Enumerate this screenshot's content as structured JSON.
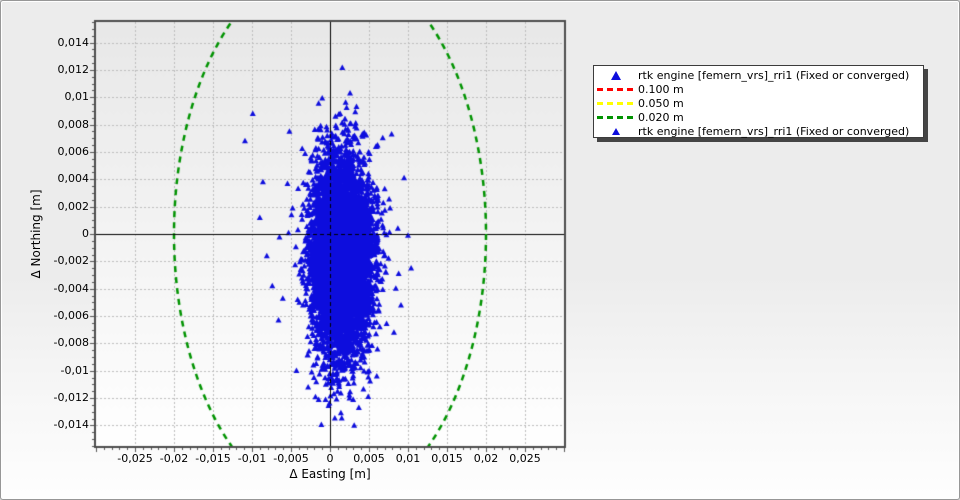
{
  "window": {
    "background_top": "#ececec",
    "background_bottom": "#fdfdfd",
    "frame_color": "#979797"
  },
  "chart_data": {
    "type": "scatter",
    "xlabel": "Δ Easting [m]",
    "ylabel": "Δ Northing [m]",
    "xlim": [
      -0.03,
      0.03
    ],
    "ylim": [
      -0.0155,
      0.0155
    ],
    "grid": "dashed-major",
    "x_ticks": {
      "values": [
        -0.025,
        -0.02,
        -0.015,
        -0.01,
        -0.005,
        0,
        0.005,
        0.01,
        0.015,
        0.02,
        0.025
      ],
      "labels": [
        "-0,025",
        "-0,02",
        "-0,015",
        "-0,01",
        "-0,005",
        "0",
        "0,005",
        "0,01",
        "0,015",
        "0,02",
        "0,025"
      ]
    },
    "y_ticks": {
      "values": [
        0.014,
        0.012,
        0.01,
        0.008,
        0.006,
        0.004,
        0.002,
        0,
        -0.002,
        -0.004,
        -0.006,
        -0.008,
        -0.01,
        -0.012,
        -0.014
      ],
      "labels": [
        "0,014",
        "0,012",
        "0,01",
        "0,008",
        "0,006",
        "0,004",
        "0,002",
        "0",
        "-0,002",
        "-0,004",
        "-0,006",
        "-0,008",
        "-0,01",
        "-0,012",
        "-0,014"
      ]
    },
    "minor_tick_step_x": 0.001,
    "minor_tick_step_y": 0.0005,
    "zero_cross_lines": true,
    "series": [
      {
        "name": "rtk engine [femern_vrs]_rri1 (Fixed or converged)",
        "marker": "triangle",
        "color": "#0d0ddd",
        "cluster": {
          "n": 7000,
          "center": [
            0.0015,
            -0.0017
          ],
          "sigma": [
            0.0019,
            0.0034
          ],
          "seed": 1337
        },
        "outliers": [
          [
            -0.0099,
            0.0088
          ],
          [
            -0.0109,
            0.0068
          ],
          [
            -0.0052,
            0.0075
          ],
          [
            0.0007,
            0.0086
          ],
          [
            0.0019,
            0.0084
          ],
          [
            0.0033,
            0.0081
          ],
          [
            -0.0012,
            0.0079
          ],
          [
            0.0044,
            0.0074
          ],
          [
            0.0013,
            0.0088
          ],
          [
            0.0061,
            0.0065
          ],
          [
            0.0079,
            0.0073
          ],
          [
            0.0095,
            0.0041
          ],
          [
            0.0087,
            0.0004
          ],
          [
            0.01,
            -0.0001
          ],
          [
            0.0104,
            -0.0025
          ],
          [
            0.0091,
            -0.0052
          ],
          [
            0.0082,
            -0.0072
          ],
          [
            -0.0074,
            -0.0038
          ],
          [
            -0.0081,
            -0.0016
          ],
          [
            -0.009,
            0.0012
          ],
          [
            -0.0086,
            0.0038
          ],
          [
            -0.0066,
            -0.0063
          ],
          [
            -0.0043,
            -0.01
          ],
          [
            -0.0028,
            -0.0112
          ],
          [
            0.0005,
            -0.0117
          ],
          [
            0.0037,
            -0.0127
          ],
          [
            0.0031,
            -0.014
          ],
          [
            0.006,
            -0.0104
          ],
          [
            0.0049,
            -0.0119
          ]
        ]
      }
    ],
    "reference_circles": [
      {
        "radius_m": 0.1,
        "label": "0.100 m",
        "color": "#ff0000"
      },
      {
        "radius_m": 0.05,
        "label": "0.050 m",
        "color": "#ffff00"
      },
      {
        "radius_m": 0.02,
        "label": "0.020 m",
        "color": "#009300"
      }
    ]
  },
  "legend": {
    "items": [
      {
        "icon": "triangle-marker",
        "color": "#0d0ddd",
        "size": "large",
        "label": "rtk engine [femern_vrs]_rri1 (Fixed or converged)"
      },
      {
        "icon": "dashed-line",
        "color": "#ff0000",
        "label": "0.100 m"
      },
      {
        "icon": "dashed-line",
        "color": "#ffff00",
        "label": "0.050 m"
      },
      {
        "icon": "dashed-line",
        "color": "#009300",
        "label": "0.020 m"
      },
      {
        "icon": "triangle-marker",
        "color": "#0d0ddd",
        "size": "small",
        "label": "rtk engine [femern_vrs]_rri1 (Fixed or converged)"
      }
    ]
  },
  "colors": {
    "plot_bg_top": "#e8e8e8",
    "plot_bg_bottom": "#ffffff",
    "grid": "#bdbdbd",
    "plot_border": "#4c4c4c",
    "zero_line": "#000000",
    "tick": "#555555",
    "text": "#000000"
  }
}
